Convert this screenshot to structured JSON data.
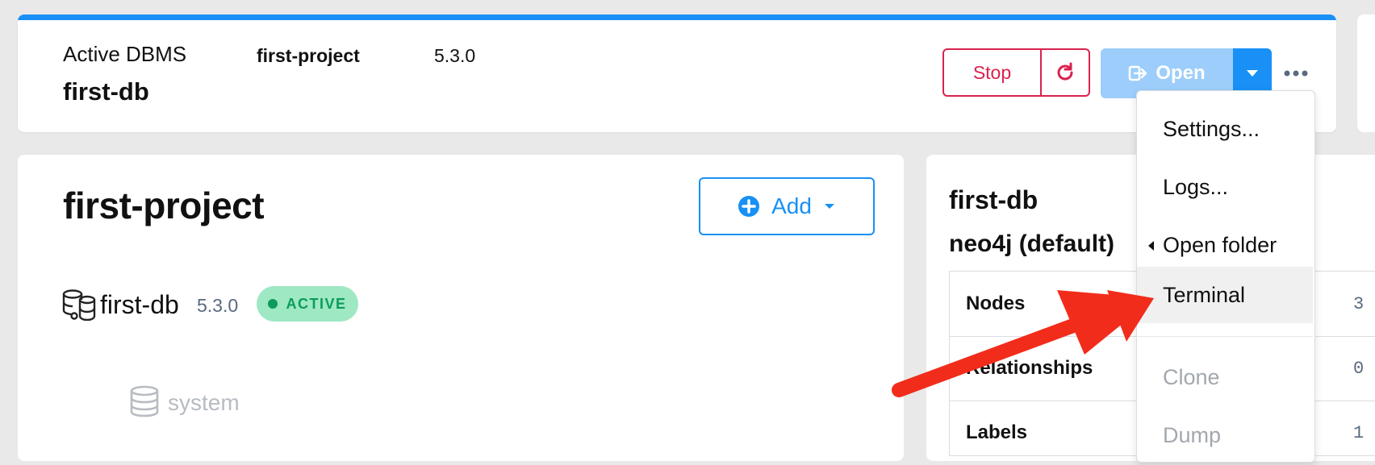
{
  "topbar": {
    "label": "Active DBMS",
    "db_name": "first-db",
    "project_name": "first-project",
    "version": "5.3.0",
    "stop_label": "Stop",
    "open_label": "Open"
  },
  "project": {
    "title": "first-project",
    "add_label": "Add",
    "dbms": {
      "name": "first-db",
      "version": "5.3.0",
      "status": "ACTIVE"
    },
    "databases": [
      {
        "name": "system"
      }
    ]
  },
  "db_details": {
    "title": "first-db",
    "database": "neo4j (default)",
    "stats": [
      {
        "label": "Nodes",
        "value": "3"
      },
      {
        "label": "Relationships",
        "value": "0"
      },
      {
        "label": "Labels",
        "value": "1"
      }
    ]
  },
  "menu": {
    "items": [
      {
        "label": "Settings..."
      },
      {
        "label": "Logs..."
      },
      {
        "label": "Open folder"
      },
      {
        "label": "Terminal"
      },
      {
        "label": "Clone"
      },
      {
        "label": "Dump"
      }
    ]
  },
  "colors": {
    "primary": "#1890f5",
    "danger": "#d9224e",
    "success": "#0c9b5b",
    "annotation": "#f22c1b"
  }
}
